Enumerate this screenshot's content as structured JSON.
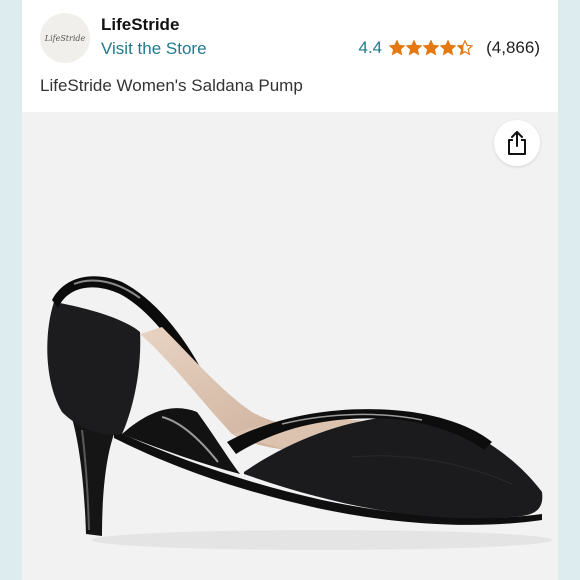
{
  "store": {
    "logo_text": "LifeStride",
    "name": "LifeStride",
    "link_label": "Visit the Store"
  },
  "rating": {
    "value_label": "4.4",
    "value": 4.4,
    "max": 5,
    "count_label": "(4,866)"
  },
  "product": {
    "title": "LifeStride Women's Saldana Pump"
  },
  "actions": {
    "share_icon": "share-icon"
  },
  "colors": {
    "link": "#1f7a8c",
    "star": "#e47911",
    "background": "#dcecef",
    "image_bg": "#f2f2f2"
  }
}
